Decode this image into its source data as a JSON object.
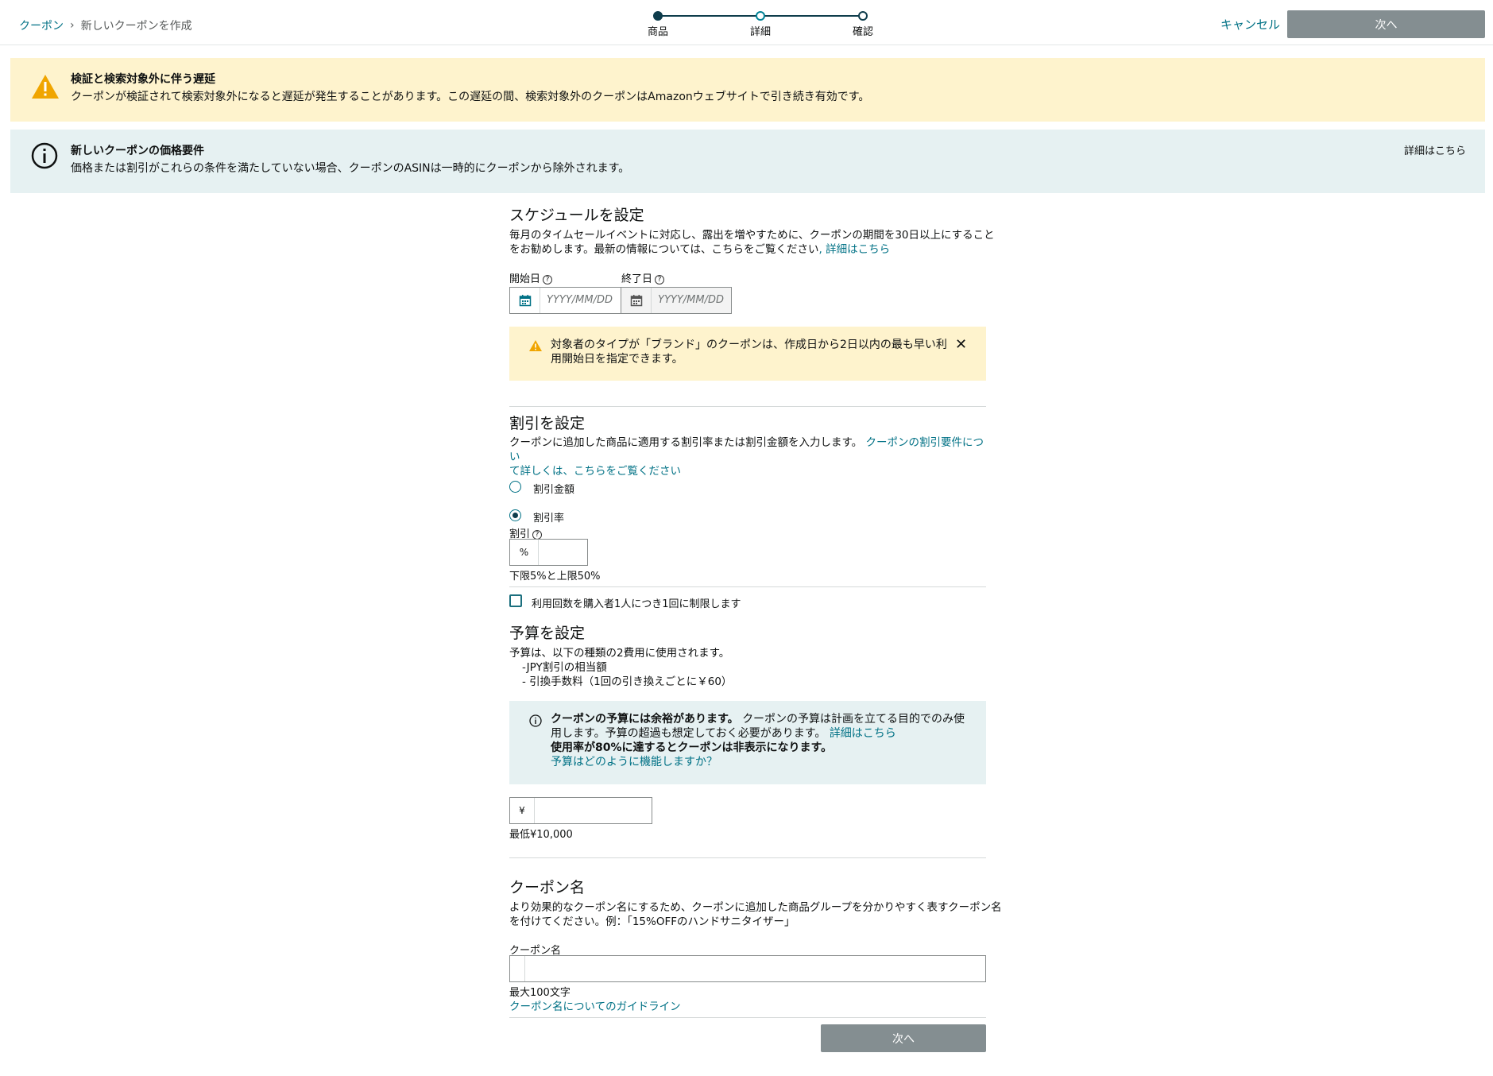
{
  "header": {
    "breadcrumb_root": "クーポン",
    "breadcrumb_current": "新しいクーポンを作成",
    "steps": [
      {
        "label": "商品"
      },
      {
        "label": "詳細"
      },
      {
        "label": "確認"
      }
    ],
    "cancel_label": "キャンセル",
    "next_label": "次へ"
  },
  "alerts": {
    "warning": {
      "title": "検証と検索対象外に伴う遅延",
      "body": "クーポンが検証されて検索対象外になると遅延が発生することがあります。この遅延の間、検索対象外のクーポンはAmazonウェブサイトで引き続き有効です。"
    },
    "info": {
      "title": "新しいクーポンの価格要件",
      "body": "価格または割引がこれらの条件を満たしていない場合、クーポンのASINは一時的にクーポンから除外されます。",
      "link": "詳細はこちら"
    }
  },
  "schedule": {
    "title": "スケジュールを設定",
    "desc_line1": "毎月のタイムセールイベントに対応し、露出を増やすために、クーポンの期間を30日以上にすること",
    "desc_line2": "をお勧めします。最新の情報については、こちらをご覧ください",
    "desc_link": ", 詳細はこちら",
    "start_label": "開始日",
    "end_label": "終了日",
    "date_placeholder": "YYYY/MM/DD",
    "notice_line1": "対象者のタイプが「ブランド」のクーポンは、作成日から2日以内の最も早い利",
    "notice_line2": "用開始日を指定できます。"
  },
  "discount": {
    "title": "割引を設定",
    "desc_line1": "クーポンに追加した商品に適用する割引率または割引金額を入力します。",
    "desc_link1": "クーポンの割引要件につい",
    "desc_link2": "て詳しくは、こちらをご覧ください",
    "option_amount": "割引金額",
    "option_percent": "割引率",
    "selected": "割引率",
    "field_label": "割引",
    "prefix": "%",
    "value": "",
    "hint": "下限5%と上限50%",
    "limit_label": "利用回数を購入者1人につき1回に制限します",
    "limit_checked": false
  },
  "budget": {
    "title": "予算を設定",
    "desc": "予算は、以下の種類の2費用に使用されます。",
    "item1": "-JPY割引の相当額",
    "item2": "- 引換手数料（1回の引き換えごとに￥60）",
    "info_bold": "クーポンの予算には余裕があります。",
    "info_text1": "クーポンの予算は計画を立てる目的でのみ使",
    "info_text2": "用します。予算の超過も想定しておく必要があります。",
    "info_link": "詳細はこちら",
    "info_bold2": "使用率が80%に達するとクーポンは非表示になります。",
    "info_link2": "予算はどのように機能しますか？",
    "prefix": "¥",
    "value": "",
    "hint": "最低¥10,000"
  },
  "coupon_name": {
    "title": "クーポン名",
    "desc_line1": "より効果的なクーポン名にするため、クーポンに追加した商品グループを分かりやすく表すクーポン名",
    "desc_line2": "を付けてください。例：「15%OFFのハンドサニタイザー」",
    "field_label": "クーポン名",
    "value": "",
    "hint": "最大100文字",
    "guideline_link": "クーポン名についてのガイドライン"
  },
  "footer": {
    "next_label": "次へ"
  },
  "colors": {
    "accent": "#007185",
    "warning_bg": "#fef3cd",
    "info_bg": "#e6f1f2",
    "disabled_button": "#848e91",
    "warning_icon": "#f0a500"
  }
}
